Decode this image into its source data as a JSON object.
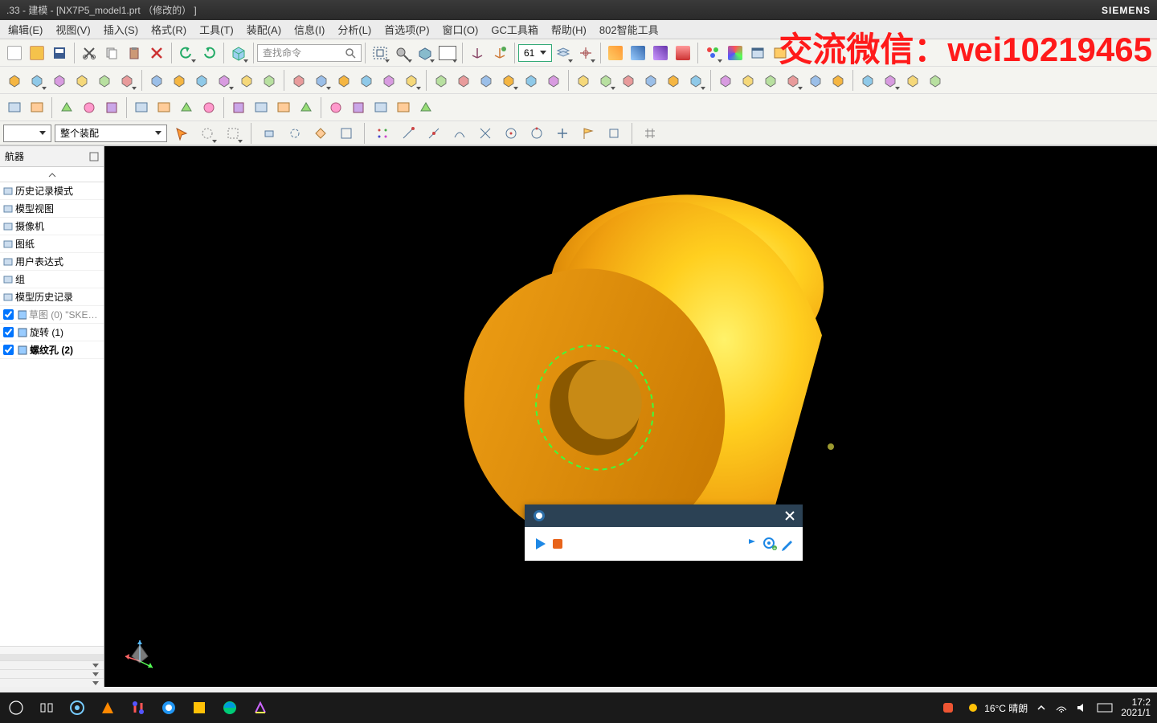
{
  "titlebar": {
    "title": ".33 - 建模 - [NX7P5_model1.prt （修改的）  ]",
    "brand": "SIEMENS"
  },
  "menu": [
    "编辑(E)",
    "视图(V)",
    "插入(S)",
    "格式(R)",
    "工具(T)",
    "装配(A)",
    "信息(I)",
    "分析(L)",
    "首选项(P)",
    "窗口(O)",
    "GC工具箱",
    "帮助(H)",
    "802智能工具"
  ],
  "toolbar": {
    "search_placeholder": "查找命令",
    "layer_value": "61"
  },
  "assembly_combo": "整个装配",
  "nav": {
    "title": "航器",
    "items": [
      "历史记录模式",
      "模型视图",
      "摄像机",
      "图纸",
      "用户表达式",
      "组",
      "模型历史记录"
    ],
    "features": [
      {
        "label": "草图 (0) \"SKETCH",
        "gray": true
      },
      {
        "label": "旋转 (1)",
        "gray": false
      },
      {
        "label": "螺纹孔 (2)",
        "gray": false,
        "bold": true
      }
    ]
  },
  "watermark": "交流微信：wei10219465",
  "taskbar": {
    "weather": "16°C 晴朗",
    "time": "17:2",
    "date": "2021/1"
  }
}
